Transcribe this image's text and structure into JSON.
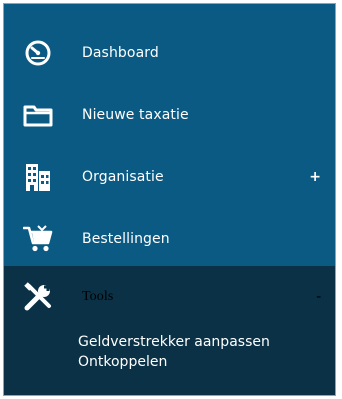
{
  "menu": {
    "items": [
      {
        "label": "Dashboard",
        "icon": "dashboard-gauge-icon"
      },
      {
        "label": "Nieuwe taxatie",
        "icon": "folder-icon"
      },
      {
        "label": "Organisatie",
        "icon": "building-icon",
        "toggle": "+"
      },
      {
        "label": "Bestellingen",
        "icon": "shopping-cart-icon"
      }
    ],
    "tools": {
      "label": "Tools",
      "icon": "wrench-screwdriver-icon",
      "toggle": "-",
      "subitems": [
        "Geldverstrekker aanpassen",
        "Ontkoppelen"
      ]
    }
  },
  "colors": {
    "sidebar_bg": "#0b5a83",
    "active_bg": "#0a3145",
    "text": "#ffffff"
  }
}
